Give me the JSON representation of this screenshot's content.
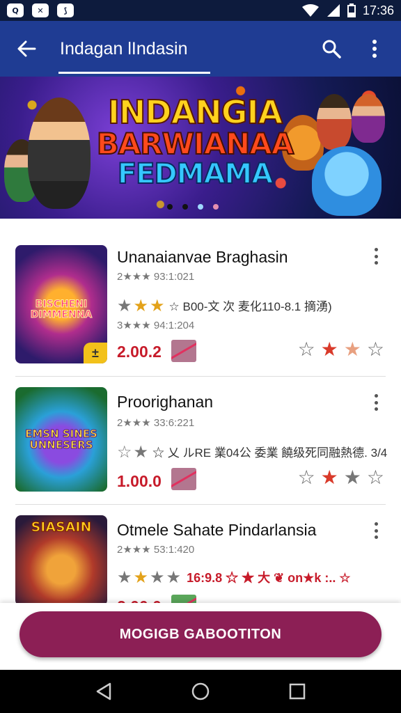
{
  "status_bar": {
    "time": "17:36",
    "left_icons": [
      "app-q-icon",
      "app-hashtag-icon",
      "app-messenger-icon"
    ],
    "left_icon_glyphs": [
      "Q",
      "✕",
      "⟆"
    ],
    "right_icons": [
      "wifi-icon",
      "signal-icon",
      "battery-icon"
    ]
  },
  "app_bar": {
    "title": "Indagan lIndasin",
    "back_icon": "arrow-left-icon",
    "search_icon": "search-icon",
    "menu_icon": "more-vert-icon",
    "background": "#1f3c93"
  },
  "banner": {
    "line1": "INDANGIA",
    "line2": "BARWIANAA",
    "line3": "FEDMAMA",
    "dots": 4,
    "active_dot": 2
  },
  "apps": [
    {
      "thumb_text": "BISCHENI DIMMENNA",
      "name": "Unanaianvae Braghasin",
      "meta1": "2★★★ 93:1:021",
      "stars_text": "☆ B00-文  次 麦化110-8.1 摘湧)",
      "meta2": "3★★★ 94:1:204",
      "price": "2.00.2",
      "badge": "±"
    },
    {
      "thumb_text": "EMSN SINES UNNESERS",
      "name": "Proorighanan",
      "meta1": "2★★★ 33:6:221",
      "stars_text": "☆ 乂 ルRE 業04公 委業 饒级死同融熱德. 3/4",
      "price": "1.00.0"
    },
    {
      "thumb_text": "SIASAIN",
      "name": "Otmele Sahate Pindarlansia",
      "meta1": "2★★★ 53:1:420",
      "stars_text": "16:9.8  ☆ ★ 大 ❦ on★k :..  ☆",
      "price": "2.00.0"
    }
  ],
  "primary_button": {
    "label": "MOGIGB GABOOTITON",
    "color": "#8c1f55"
  },
  "nav_bar": {
    "buttons": [
      "back-triangle-icon",
      "home-circle-icon",
      "recents-square-icon"
    ]
  }
}
